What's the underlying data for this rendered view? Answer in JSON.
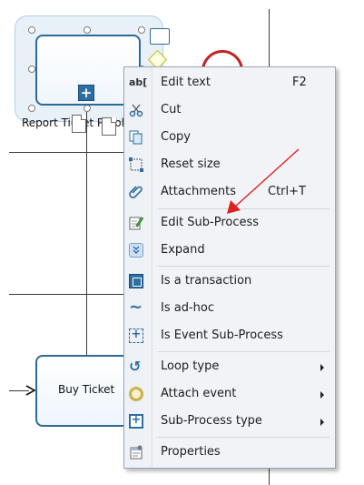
{
  "diagram": {
    "selected_task_label": "Report Ticket Problem",
    "task_label": "Buy Ticket"
  },
  "menu": {
    "items": [
      {
        "label": "Edit text",
        "shortcut": "F2",
        "icon": "edit-text-icon"
      },
      {
        "label": "Cut",
        "icon": "scissors-icon"
      },
      {
        "label": "Copy",
        "icon": "copy-icon"
      },
      {
        "label": "Reset size",
        "icon": "reset-size-icon"
      },
      {
        "label": "Attachments",
        "shortcut": "Ctrl+T",
        "icon": "paperclip-icon"
      },
      {
        "label": "Edit Sub-Process",
        "icon": "edit-notepad-icon"
      },
      {
        "label": "Expand",
        "icon": "expand-icon"
      },
      {
        "label": "Is a transaction",
        "icon": "transaction-icon"
      },
      {
        "label": "Is ad-hoc",
        "icon": "tilde-icon"
      },
      {
        "label": "Is Event Sub-Process",
        "icon": "event-subprocess-icon"
      },
      {
        "label": "Loop type",
        "icon": "loop-icon",
        "submenu": true
      },
      {
        "label": "Attach event",
        "icon": "event-circle-icon",
        "submenu": true
      },
      {
        "label": "Sub-Process type",
        "icon": "subprocess-type-icon",
        "submenu": true
      },
      {
        "label": "Properties",
        "icon": "properties-icon"
      }
    ],
    "icon_glyphs": {
      "edit-text": "ab[",
      "loop": "↺",
      "tilde": "∼"
    }
  },
  "colors": {
    "accent_blue": "#2e6fa3",
    "annotation_arrow": "#e02020",
    "end_event": "#c02424"
  }
}
